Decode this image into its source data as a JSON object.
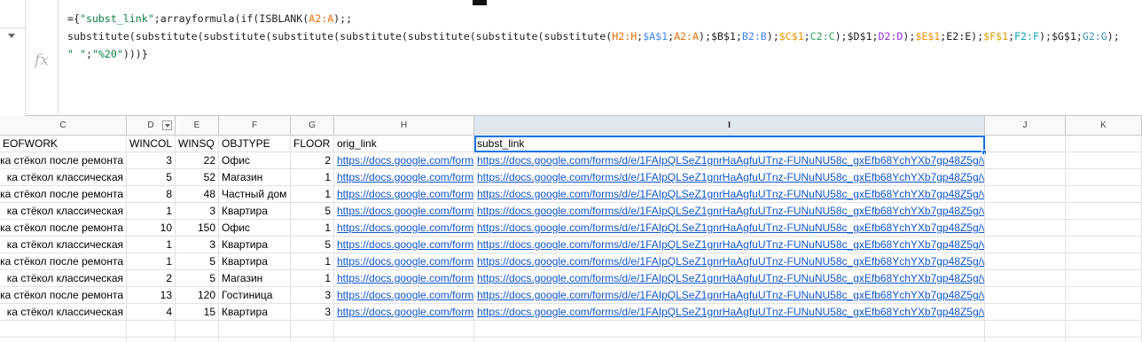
{
  "formula": {
    "line1_a": "={",
    "line1_str": "\"subst_link\"",
    "line1_b": ";arrayformula(if(ISBLANK(",
    "line1_ref": "A2:A",
    "line1_c": ");;",
    "line2_a": "substitute(substitute(substitute(substitute(substitute(substitute(substitute(substitute(",
    "h": "H2:H",
    "a1": "$A$1",
    "aa": "A2:A",
    "b1": "$B$1",
    "bb": "B2:B",
    "c1": "$C$1",
    "cc": "C2:C",
    "d1": "$D$1",
    "dd": "D2:D",
    "e1": "$E$1",
    "ee": "E2:E",
    "f1": "$F$1",
    "ff": "F2:F",
    "g1": "$G$1",
    "gg": "G2:G",
    "line3_str1": "\" \"",
    "line3_str2": "\"%20\"",
    "line3_end": ")))}"
  },
  "columns": [
    "C",
    "D",
    "E",
    "F",
    "G",
    "H",
    "I",
    "J",
    "K"
  ],
  "header_row": {
    "C": "EOFWORK",
    "D": "WINCOL",
    "E": "WINSQ",
    "F": "OBJTYPE",
    "G": "FLOOR",
    "H": "orig_link",
    "I": "subst_link"
  },
  "rows": [
    {
      "C": "ка стёкол после ремонта",
      "D": "3",
      "E": "22",
      "F": "Офис",
      "G": "2",
      "H": "https://docs.google.com/form",
      "I": "https://docs.google.com/forms/d/e/1FAIpQLSeZ1gnrHaAgfuUTnz-FUNuNU58c_gxEfb68YchYXb7gp48Z5g/v"
    },
    {
      "C": "ка стёкол классическая",
      "D": "5",
      "E": "52",
      "F": "Магазин",
      "G": "1",
      "H": "https://docs.google.com/form",
      "I": "https://docs.google.com/forms/d/e/1FAIpQLSeZ1gnrHaAgfuUTnz-FUNuNU58c_gxEfb68YchYXb7gp48Z5g/v"
    },
    {
      "C": "ка стёкол после ремонта",
      "D": "8",
      "E": "48",
      "F": "Частный дом",
      "G": "1",
      "H": "https://docs.google.com/form",
      "I": "https://docs.google.com/forms/d/e/1FAIpQLSeZ1gnrHaAgfuUTnz-FUNuNU58c_gxEfb68YchYXb7gp48Z5g/v"
    },
    {
      "C": "ка стёкол классическая",
      "D": "1",
      "E": "3",
      "F": "Квартира",
      "G": "5",
      "H": "https://docs.google.com/form",
      "I": "https://docs.google.com/forms/d/e/1FAIpQLSeZ1gnrHaAgfuUTnz-FUNuNU58c_gxEfb68YchYXb7gp48Z5g/v"
    },
    {
      "C": "ка стёкол после ремонта",
      "D": "10",
      "E": "150",
      "F": "Офис",
      "G": "1",
      "H": "https://docs.google.com/form",
      "I": "https://docs.google.com/forms/d/e/1FAIpQLSeZ1gnrHaAgfuUTnz-FUNuNU58c_gxEfb68YchYXb7gp48Z5g/v"
    },
    {
      "C": "ка стёкол классическая",
      "D": "1",
      "E": "3",
      "F": "Квартира",
      "G": "5",
      "H": "https://docs.google.com/form",
      "I": "https://docs.google.com/forms/d/e/1FAIpQLSeZ1gnrHaAgfuUTnz-FUNuNU58c_gxEfb68YchYXb7gp48Z5g/v"
    },
    {
      "C": "ка стёкол после ремонта",
      "D": "1",
      "E": "5",
      "F": "Квартира",
      "G": "1",
      "H": "https://docs.google.com/form",
      "I": "https://docs.google.com/forms/d/e/1FAIpQLSeZ1gnrHaAgfuUTnz-FUNuNU58c_gxEfb68YchYXb7gp48Z5g/v"
    },
    {
      "C": "ка стёкол классическая",
      "D": "2",
      "E": "5",
      "F": "Магазин",
      "G": "1",
      "H": "https://docs.google.com/form",
      "I": "https://docs.google.com/forms/d/e/1FAIpQLSeZ1gnrHaAgfuUTnz-FUNuNU58c_gxEfb68YchYXb7gp48Z5g/v"
    },
    {
      "C": "ка стёкол после ремонта",
      "D": "13",
      "E": "120",
      "F": "Гостиница",
      "G": "3",
      "H": "https://docs.google.com/form",
      "I": "https://docs.google.com/forms/d/e/1FAIpQLSeZ1gnrHaAgfuUTnz-FUNuNU58c_gxEfb68YchYXb7gp48Z5g/v"
    },
    {
      "C": "ка стёкол классическая",
      "D": "4",
      "E": "15",
      "F": "Квартира",
      "G": "3",
      "H": "https://docs.google.com/form",
      "I": "https://docs.google.com/forms/d/e/1FAIpQLSeZ1gnrHaAgfuUTnz-FUNuNU58c_gxEfb68YchYXb7gp48Z5g/v"
    }
  ]
}
